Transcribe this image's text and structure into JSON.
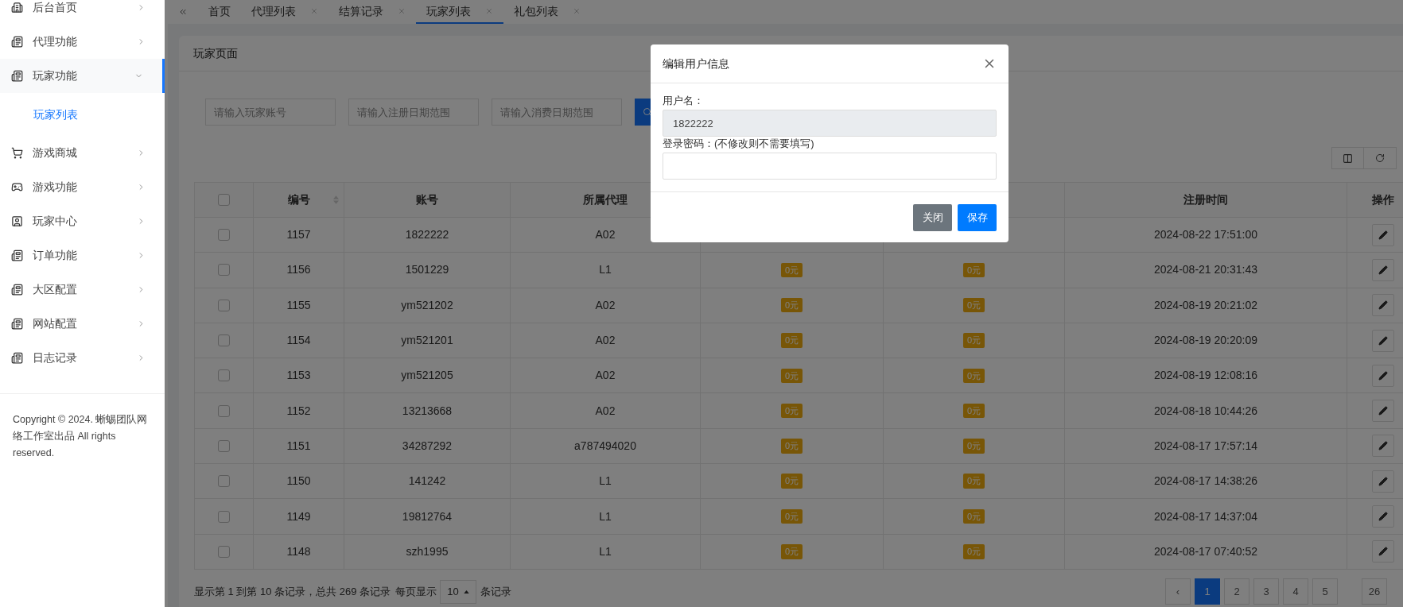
{
  "sidebar": {
    "items": [
      {
        "label": "后台首页",
        "expanded": false
      },
      {
        "label": "代理功能",
        "expanded": false
      },
      {
        "label": "玩家功能",
        "expanded": true,
        "children": [
          {
            "label": "玩家列表",
            "selected": true
          }
        ]
      },
      {
        "label": "游戏商城",
        "expanded": false
      },
      {
        "label": "游戏功能",
        "expanded": false
      },
      {
        "label": "玩家中心",
        "expanded": false
      },
      {
        "label": "订单功能",
        "expanded": false
      },
      {
        "label": "大区配置",
        "expanded": false
      },
      {
        "label": "网站配置",
        "expanded": false
      },
      {
        "label": "日志记录",
        "expanded": false
      }
    ],
    "copyright": "Copyright © 2024. 蜥蜴团队网络工作室出品 All rights reserved."
  },
  "tabs": [
    {
      "label": "首页",
      "closable": false,
      "selected": false
    },
    {
      "label": "代理列表",
      "closable": true,
      "selected": false
    },
    {
      "label": "结算记录",
      "closable": true,
      "selected": false
    },
    {
      "label": "玩家列表",
      "closable": true,
      "selected": true
    },
    {
      "label": "礼包列表",
      "closable": true,
      "selected": false
    }
  ],
  "panel": {
    "title": "玩家页面",
    "filters": [
      {
        "placeholder": "请输入玩家账号"
      },
      {
        "placeholder": "请输入注册日期范围"
      },
      {
        "placeholder": "请输入消费日期范围"
      }
    ],
    "table": {
      "header_checked": false,
      "columns": [
        "编号",
        "账号",
        "所属代理",
        "",
        "",
        "注册时间",
        "操作"
      ],
      "rows": [
        {
          "checked": false,
          "id": "1157",
          "account": "1822222",
          "agent": "A02",
          "registered": "2024-08-22 17:51:00"
        },
        {
          "checked": false,
          "id": "1156",
          "account": "1501229",
          "agent": "L1",
          "column_5": "0元",
          "column_6": "0元",
          "registered": "2024-08-21 20:31:43"
        },
        {
          "checked": false,
          "id": "1155",
          "account": "ym521202",
          "agent": "A02",
          "column_5": "0元",
          "column_6": "0元",
          "registered": "2024-08-19 20:21:02"
        },
        {
          "checked": false,
          "id": "1154",
          "account": "ym521201",
          "agent": "A02",
          "column_5": "0元",
          "column_6": "0元",
          "registered": "2024-08-19 20:20:09"
        },
        {
          "checked": false,
          "id": "1153",
          "account": "ym521205",
          "agent": "A02",
          "column_5": "0元",
          "column_6": "0元",
          "registered": "2024-08-19 12:08:16"
        },
        {
          "checked": false,
          "id": "1152",
          "account": "13213668",
          "agent": "A02",
          "column_5": "0元",
          "column_6": "0元",
          "registered": "2024-08-18 10:44:26"
        },
        {
          "checked": false,
          "id": "1151",
          "account": "34287292",
          "agent": "a787494020",
          "column_5": "0元",
          "column_6": "0元",
          "registered": "2024-08-17 17:57:14"
        },
        {
          "checked": false,
          "id": "1150",
          "account": "141242",
          "agent": "L1",
          "column_5": "0元",
          "column_6": "0元",
          "registered": "2024-08-17 14:38:26"
        },
        {
          "checked": false,
          "id": "1149",
          "account": "19812764",
          "agent": "L1",
          "column_5": "0元",
          "column_6": "0元",
          "registered": "2024-08-17 14:37:04"
        },
        {
          "checked": false,
          "id": "1148",
          "account": "szh1995",
          "agent": "L1",
          "column_5": "0元",
          "column_6": "0元",
          "registered": "2024-08-17 07:40:52"
        }
      ]
    },
    "footer": {
      "summary": "显示第 1 到第 10 条记录，总共 269 条记录",
      "per_page_label": "每页显示",
      "page_size": "10",
      "per_page_suffix": "条记录"
    },
    "pagination": {
      "prev": "‹",
      "pages": [
        {
          "label": "1",
          "selected": true
        },
        {
          "label": "2",
          "selected": false
        },
        {
          "label": "3",
          "selected": false
        },
        {
          "label": "4",
          "selected": false
        },
        {
          "label": "5",
          "selected": false
        },
        {
          "label": "26",
          "selected": false
        }
      ]
    }
  },
  "dialog": {
    "title": "编辑用户信息",
    "fields": [
      {
        "label": "用户名：",
        "value": "1822222",
        "disabled": true
      },
      {
        "label": "登录密码：(不修改则不需要填写)",
        "disabled": false
      }
    ],
    "buttons": [
      {
        "label": "关闭",
        "kind": "secondary"
      },
      {
        "label": "保存",
        "kind": "primary"
      }
    ]
  }
}
